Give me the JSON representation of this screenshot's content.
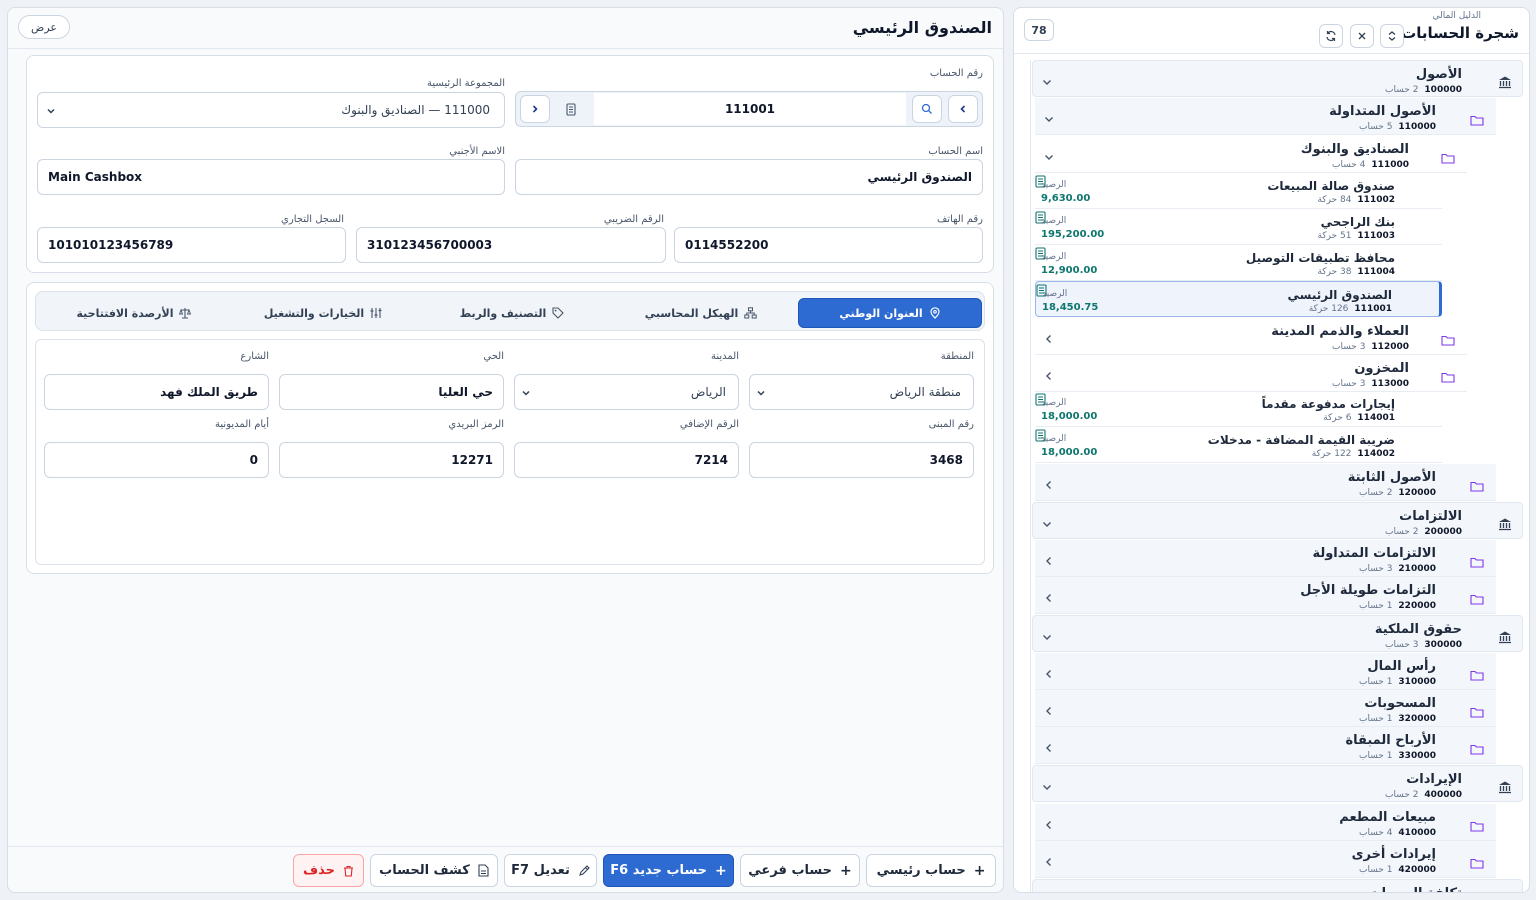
{
  "tree": {
    "subtitle": "الدليل المالي",
    "title": "شجرة الحسابات",
    "count": "78",
    "balance_label": "الرصيد",
    "nodes": [
      {
        "name": "الأصول",
        "code": "100000",
        "meta": "2 حساب"
      },
      {
        "name": "الأصول المتداولة",
        "code": "110000",
        "meta": "5 حساب"
      },
      {
        "name": "الصناديق والبنوك",
        "code": "111000",
        "meta": "4 حساب"
      },
      {
        "name": "صندوق صالة المبيعات",
        "code": "111002",
        "meta": "84 حركة",
        "balance": "9,630.00"
      },
      {
        "name": "بنك الراجحي",
        "code": "111003",
        "meta": "51 حركة",
        "balance": "195,200.00"
      },
      {
        "name": "محافظ تطبيقات التوصيل",
        "code": "111004",
        "meta": "38 حركة",
        "balance": "12,900.00"
      },
      {
        "name": "الصندوق الرئيسي",
        "code": "111001",
        "meta": "126 حركة",
        "balance": "18,450.75"
      },
      {
        "name": "العملاء والذمم المدينة",
        "code": "112000",
        "meta": "3 حساب"
      },
      {
        "name": "المخزون",
        "code": "113000",
        "meta": "3 حساب"
      },
      {
        "name": "إيجارات مدفوعة مقدماً",
        "code": "114001",
        "meta": "6 حركة",
        "balance": "18,000.00"
      },
      {
        "name": "ضريبة القيمة المضافة - مدخلات",
        "code": "114002",
        "meta": "122 حركة",
        "balance": "18,000.00"
      },
      {
        "name": "الأصول الثابتة",
        "code": "120000",
        "meta": "2 حساب"
      },
      {
        "name": "الالتزامات",
        "code": "200000",
        "meta": "2 حساب"
      },
      {
        "name": "الالتزامات المتداولة",
        "code": "210000",
        "meta": "3 حساب"
      },
      {
        "name": "التزامات طويلة الأجل",
        "code": "220000",
        "meta": "1 حساب"
      },
      {
        "name": "حقوق الملكية",
        "code": "300000",
        "meta": "3 حساب"
      },
      {
        "name": "رأس المال",
        "code": "310000",
        "meta": "1 حساب"
      },
      {
        "name": "المسحوبات",
        "code": "320000",
        "meta": "1 حساب"
      },
      {
        "name": "الأرباح المبقاة",
        "code": "330000",
        "meta": "1 حساب"
      },
      {
        "name": "الإيرادات",
        "code": "400000",
        "meta": "2 حساب"
      },
      {
        "name": "مبيعات المطعم",
        "code": "410000",
        "meta": "4 حساب"
      },
      {
        "name": "إيرادات أخرى",
        "code": "420000",
        "meta": "1 حساب"
      },
      {
        "name": "تكلفة المبيعات",
        "code": "",
        "meta": ""
      }
    ]
  },
  "form": {
    "title": "الصندوق الرئيسي",
    "view_button": "عرض",
    "labels": {
      "account_number": "رقم الحساب",
      "main_group": "المجموعة الرئيسية",
      "account_name": "اسم الحساب",
      "foreign_name": "الاسم الأجنبي",
      "phone": "رقم الهاتف",
      "tax_number": "الرقم الضريبي",
      "commercial_register": "السجل التجاري"
    },
    "values": {
      "account_number": "111001",
      "main_group": "111000 — الصناديق والبنوك",
      "account_name": "الصندوق الرئيسي",
      "foreign_name": "Main Cashbox",
      "phone": "0114552200",
      "tax_number": "310123456700003",
      "commercial_register": "101010123456789"
    },
    "tabs": [
      "العنوان الوطني",
      "الهيكل المحاسبي",
      "التصنيف والربط",
      "الخيارات والتشغيل",
      "الأرصدة الافتتاحية"
    ],
    "address": {
      "labels": {
        "region": "المنطقة",
        "city": "المدينة",
        "district": "الحي",
        "street": "الشارع",
        "building": "رقم المبنى",
        "additional": "الرقم الإضافي",
        "postal": "الرمز البريدي",
        "debt_days": "أيام المديونية"
      },
      "values": {
        "region": "منطقة الرياض",
        "city": "الرياض",
        "district": "حي العليا",
        "street": "طريق الملك فهد",
        "building": "3468",
        "additional": "7214",
        "postal": "12271",
        "debt_days": "0"
      }
    }
  },
  "footer": {
    "main_account": "حساب رئيسي",
    "sub_account": "حساب فرعي",
    "new_account": "حساب جديد F6",
    "edit": "تعديل F7",
    "statement": "كشف الحساب",
    "delete": "حذف"
  },
  "colors": {
    "accent": "#2d6ad1",
    "balance": "#0f766e",
    "danger": "#dc2626"
  }
}
